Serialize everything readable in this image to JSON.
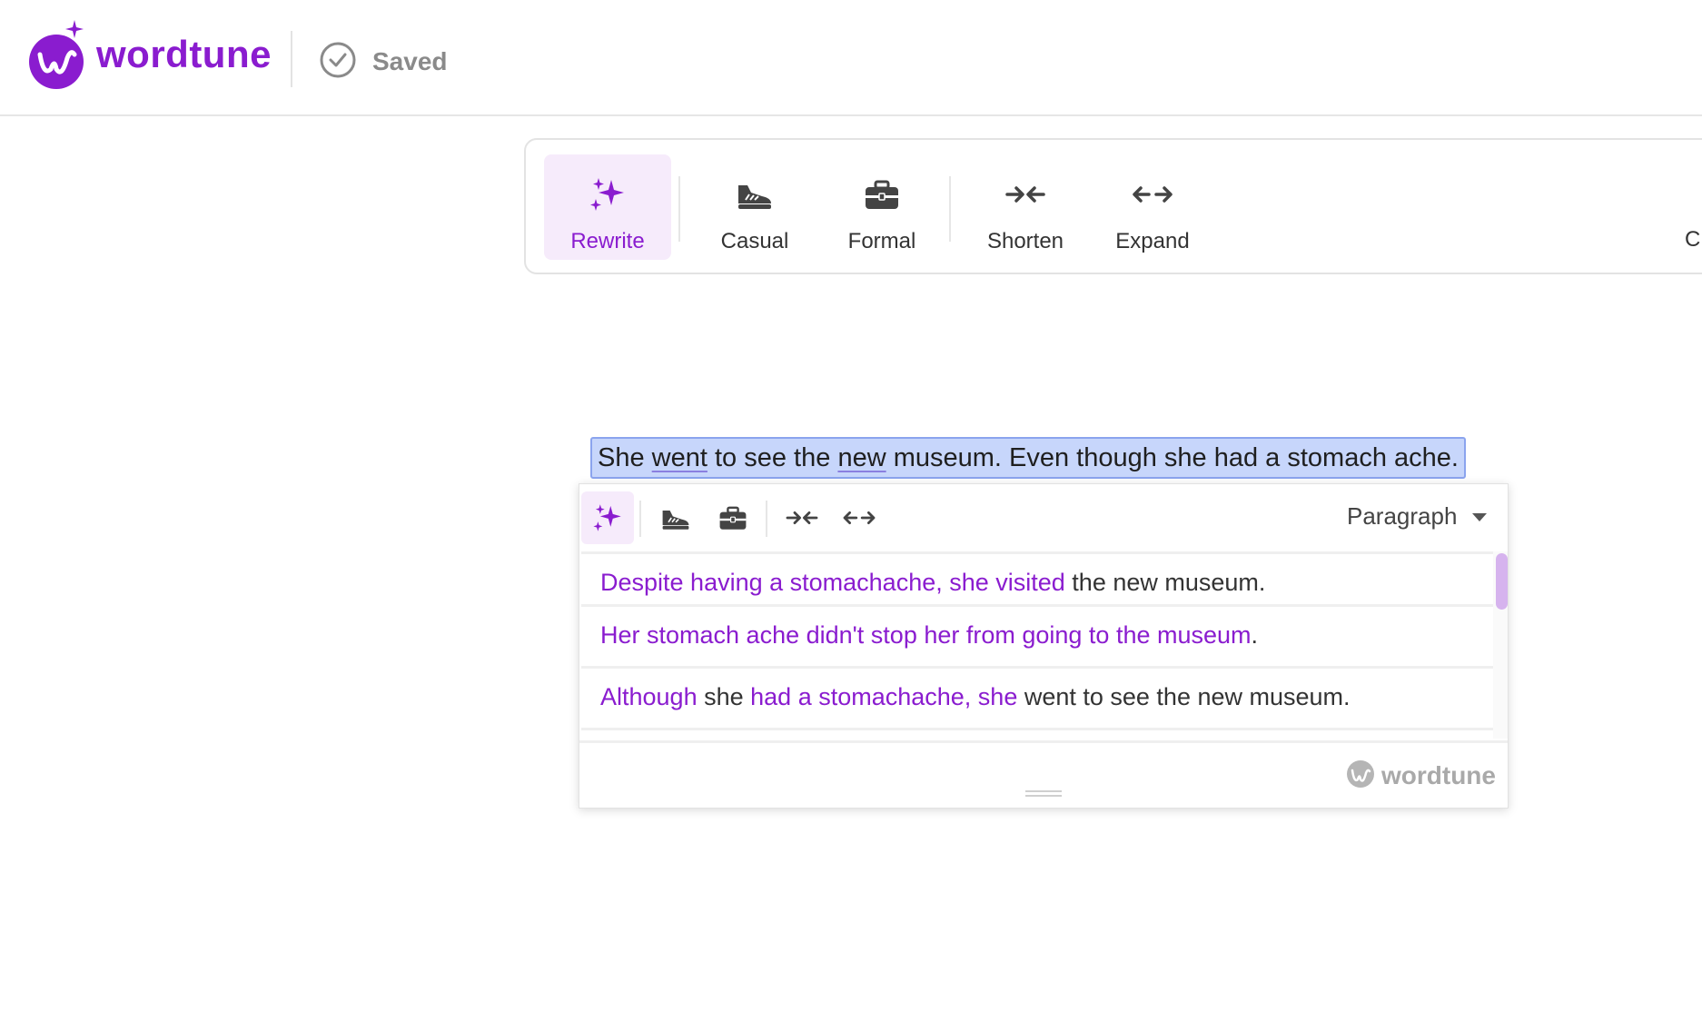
{
  "header": {
    "logo_text": "wordtune",
    "status": "Saved"
  },
  "toolbar": {
    "items": [
      {
        "label": "Rewrite",
        "icon": "sparkles-icon",
        "active": true
      },
      {
        "label": "Casual",
        "icon": "sneaker-icon"
      },
      {
        "label": "Formal",
        "icon": "briefcase-icon"
      },
      {
        "label": "Shorten",
        "icon": "arrows-in-icon"
      },
      {
        "label": "Expand",
        "icon": "arrows-out-icon"
      }
    ],
    "cut_label": "C"
  },
  "editor": {
    "sel_1": "She ",
    "sel_2": "went",
    "sel_3": " to see the ",
    "sel_4": "new",
    "sel_5": " museum. Even though she had a stomach ache."
  },
  "popup": {
    "mode": "Paragraph",
    "suggestions": [
      {
        "s1": "Despite having a stomachache, she visited",
        "s2": " the new museum."
      },
      {
        "s1": "Her stomach ache didn't stop her from going to the museum",
        "s2": "."
      },
      {
        "s1": "Although",
        "s2": " she ",
        "s3": "had a stomachache, she",
        "s4": " went to see the new museum."
      }
    ],
    "footer_logo": "wordtune"
  },
  "colors": {
    "brand": "#8a1ccf",
    "selection": "#c7d6fb",
    "active_bg": "#f6ebfb"
  }
}
